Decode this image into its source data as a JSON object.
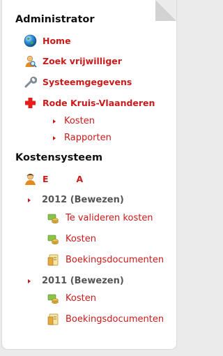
{
  "admin": {
    "heading": "Administrator",
    "items": [
      {
        "label": "Home",
        "icon": "globe-icon"
      },
      {
        "label": "Zoek vrijwilliger",
        "icon": "user-search-icon"
      },
      {
        "label": "Systeemgegevens",
        "icon": "wrench-icon"
      },
      {
        "label": "Rode Kruis-Vlaanderen",
        "icon": "red-cross-icon"
      }
    ],
    "sub": [
      "Kosten",
      "Rapporten"
    ]
  },
  "kosten": {
    "heading": "Kostensysteem",
    "user": {
      "first": "E",
      "second": "A",
      "icon": "user-icon"
    },
    "years": [
      {
        "label": "2012 (Bewezen)",
        "items": [
          {
            "label": "Te valideren kosten",
            "icon": "coins-icon"
          },
          {
            "label": "Kosten",
            "icon": "coins-icon"
          },
          {
            "label": "Boekingsdocumenten",
            "icon": "document-icon"
          }
        ]
      },
      {
        "label": "2011 (Bewezen)",
        "items": [
          {
            "label": "Kosten",
            "icon": "coins-icon"
          },
          {
            "label": "Boekingsdocumenten",
            "icon": "document-icon"
          }
        ]
      }
    ]
  },
  "colors": {
    "link": "#cc1a1a",
    "heading": "#111111",
    "year": "#555555"
  }
}
